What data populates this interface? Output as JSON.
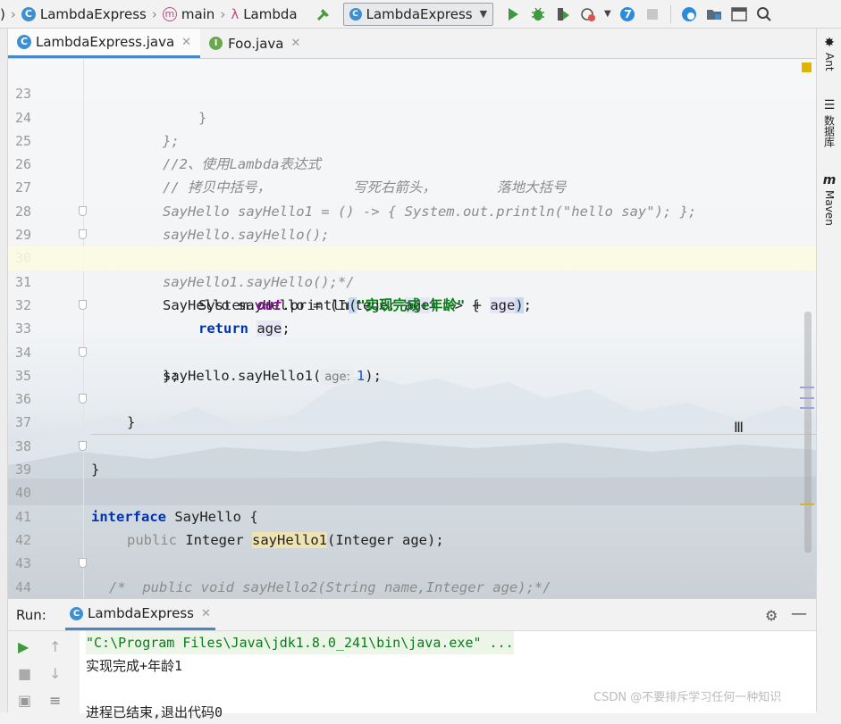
{
  "navbar": {
    "project": "LambdaExpress",
    "method": "main",
    "lambda": "Lambda",
    "run_config": "LambdaExpress"
  },
  "tabs": [
    {
      "label": "LambdaExpress.java",
      "icon": "class-icon"
    },
    {
      "label": "Foo.java",
      "icon": "interface-icon"
    }
  ],
  "right_tools": [
    "Ant",
    "数据库",
    "Maven"
  ],
  "editor": {
    "current_line": 31,
    "lines": [
      {
        "no": "23"
      },
      {
        "no": "24"
      },
      {
        "no": "25",
        "text": "//2、使用Lambda表达式"
      },
      {
        "no": "26",
        "a": "// 拷贝中括号，",
        "b": "写死右箭头，",
        "c": "落地大括号"
      },
      {
        "no": "27",
        "text": "SayHello sayHello1 = () -> { System.out.println(\"hello say\"); };"
      },
      {
        "no": "28",
        "text": "sayHello.sayHello();"
      },
      {
        "no": "29",
        "text": "sayHello1.sayHello();*/"
      },
      {
        "no": "30",
        "a": "SayHello sayHello = (Integer ",
        "b": "age",
        "c": ") -> {"
      },
      {
        "no": "31",
        "a": "System.",
        "b": "out",
        "c": ".println",
        "d": "(",
        "e": "\"实现完成+年龄\"",
        "f": " + ",
        "g": "age",
        "h": ")",
        "i": ";"
      },
      {
        "no": "32",
        "a": "return",
        "b": "age",
        "c": ";"
      },
      {
        "no": "33",
        "text": "};"
      },
      {
        "no": "34",
        "a": "sayHello.sayHello1(",
        "hint": "age:",
        "b": "1",
        "c": ");"
      },
      {
        "no": "35",
        "text": "}"
      },
      {
        "no": "36"
      },
      {
        "no": "37",
        "text": "}"
      },
      {
        "no": "38"
      },
      {
        "no": "39",
        "a": "interface",
        "b": " SayHello {"
      },
      {
        "no": "40"
      },
      {
        "no": "41",
        "a": "public",
        "b": " Integer ",
        "c": "sayHello1",
        "d": "(Integer age);"
      },
      {
        "no": "42"
      },
      {
        "no": "43",
        "text": "/*  public void sayHello2(String name,Integer age);*/"
      },
      {
        "no": "44",
        "text": "}"
      }
    ]
  },
  "run": {
    "label": "Run:",
    "tab": "LambdaExpress",
    "console": [
      "\"C:\\Program Files\\Java\\jdk1.8.0_241\\bin\\java.exe\" ...",
      "实现完成+年龄1",
      "",
      "进程已结束,退出代码0"
    ]
  },
  "watermark": "CSDN @不要排斥学习任何一种知识",
  "colors": {
    "keyword": "#0033b3",
    "string": "#067d17",
    "comment": "#8c8c8c",
    "field": "#871094",
    "number": "#1750eb",
    "accent": "#4a87c9"
  }
}
